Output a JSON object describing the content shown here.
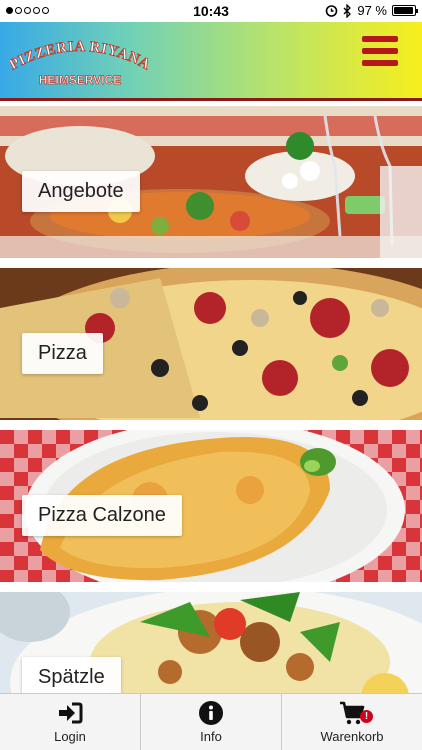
{
  "status_bar": {
    "time": "10:43",
    "battery": "97 %",
    "battery_level": 0.97
  },
  "header": {
    "logo_line1": "PIZZERIA RIYANA",
    "logo_line2": "HEIMSERVICE",
    "menu_icon": "hamburger-menu-icon",
    "accent_color": "#b5171a"
  },
  "categories": [
    {
      "label": "Angebote"
    },
    {
      "label": "Pizza"
    },
    {
      "label": "Pizza Calzone"
    },
    {
      "label": "Spätzle"
    }
  ],
  "tabbar": {
    "login": {
      "label": "Login",
      "icon": "sign-in-icon"
    },
    "info": {
      "label": "Info",
      "icon": "info-icon"
    },
    "cart": {
      "label": "Warenkorb",
      "icon": "cart-icon",
      "badge": "!"
    }
  }
}
